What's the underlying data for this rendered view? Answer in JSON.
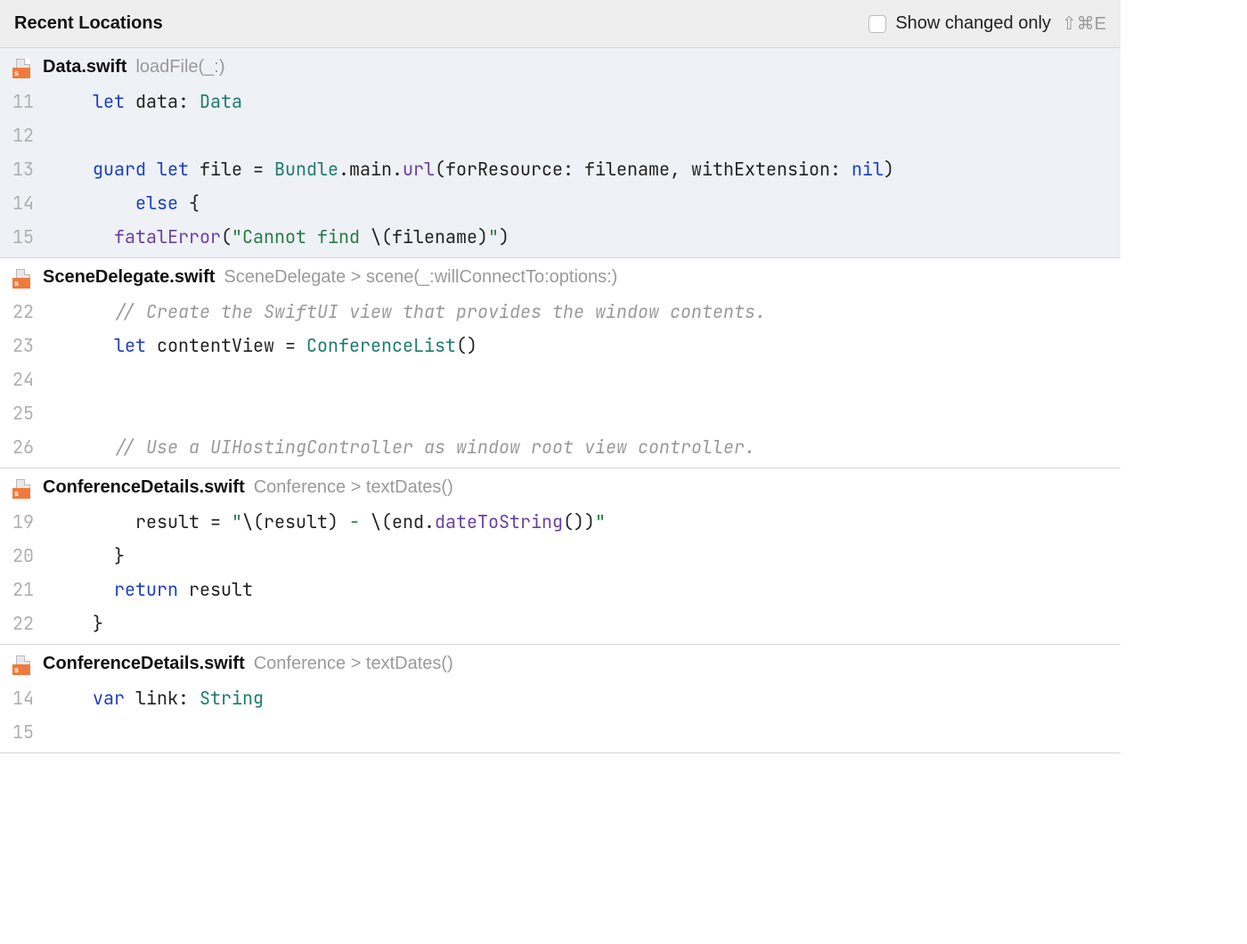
{
  "header": {
    "title": "Recent Locations",
    "show_changed_label": "Show changed only",
    "shortcut": "⇧⌘E"
  },
  "locations": [
    {
      "filename": "Data.swift",
      "path": "loadFile(_:)",
      "selected": true,
      "lines": [
        {
          "n": 11,
          "tokens": [
            [
              "    ",
              "pl"
            ],
            [
              "let",
              "kw"
            ],
            [
              " ",
              "pl"
            ],
            [
              "data",
              "id"
            ],
            [
              ": ",
              "pl"
            ],
            [
              "Data",
              "type"
            ]
          ]
        },
        {
          "n": 12,
          "tokens": []
        },
        {
          "n": 13,
          "tokens": [
            [
              "    ",
              "pl"
            ],
            [
              "guard",
              "kw"
            ],
            [
              " ",
              "pl"
            ],
            [
              "let",
              "kw"
            ],
            [
              " ",
              "pl"
            ],
            [
              "file",
              "id"
            ],
            [
              " = ",
              "pl"
            ],
            [
              "Bundle",
              "type"
            ],
            [
              ".main.",
              "pl"
            ],
            [
              "url",
              "fn"
            ],
            [
              "(forResource: filename, withExtension: ",
              "pl"
            ],
            [
              "nil",
              "nil"
            ],
            [
              ")",
              "pl"
            ]
          ]
        },
        {
          "n": 14,
          "tokens": [
            [
              "        ",
              "pl"
            ],
            [
              "else",
              "kw"
            ],
            [
              " {",
              "pl"
            ]
          ]
        },
        {
          "n": 15,
          "tokens": [
            [
              "      ",
              "pl"
            ],
            [
              "fatalError",
              "fn"
            ],
            [
              "(",
              "pl"
            ],
            [
              "\"Cannot find ",
              "str"
            ],
            [
              "\\(",
              "pl"
            ],
            [
              "filename",
              "id"
            ],
            [
              ")",
              "pl"
            ],
            [
              "\"",
              "str"
            ],
            [
              ")",
              "pl"
            ]
          ]
        }
      ]
    },
    {
      "filename": "SceneDelegate.swift",
      "path": "SceneDelegate > scene(_:willConnectTo:options:)",
      "selected": false,
      "lines": [
        {
          "n": 22,
          "tokens": [
            [
              "      ",
              "pl"
            ],
            [
              "// Create the SwiftUI view that provides the window contents.",
              "cmt"
            ]
          ]
        },
        {
          "n": 23,
          "tokens": [
            [
              "      ",
              "pl"
            ],
            [
              "let",
              "kw"
            ],
            [
              " ",
              "pl"
            ],
            [
              "contentView",
              "id"
            ],
            [
              " = ",
              "pl"
            ],
            [
              "ConferenceList",
              "type"
            ],
            [
              "()",
              "pl"
            ]
          ]
        },
        {
          "n": 24,
          "tokens": []
        },
        {
          "n": 25,
          "tokens": []
        },
        {
          "n": 26,
          "tokens": [
            [
              "      ",
              "pl"
            ],
            [
              "// Use a UIHostingController as window root view controller.",
              "cmt"
            ]
          ]
        }
      ]
    },
    {
      "filename": "ConferenceDetails.swift",
      "path": "Conference > textDates()",
      "selected": false,
      "lines": [
        {
          "n": 19,
          "tokens": [
            [
              "        ",
              "pl"
            ],
            [
              "result",
              "id"
            ],
            [
              " = ",
              "pl"
            ],
            [
              "\"",
              "str"
            ],
            [
              "\\(",
              "pl"
            ],
            [
              "result",
              "id"
            ],
            [
              ")",
              "pl"
            ],
            [
              " - ",
              "str"
            ],
            [
              "\\(",
              "pl"
            ],
            [
              "end",
              "id"
            ],
            [
              ".",
              "pl"
            ],
            [
              "dateToString",
              "fn"
            ],
            [
              "())",
              "pl"
            ],
            [
              "\"",
              "str"
            ]
          ]
        },
        {
          "n": 20,
          "tokens": [
            [
              "      }",
              "pl"
            ]
          ]
        },
        {
          "n": 21,
          "tokens": [
            [
              "      ",
              "pl"
            ],
            [
              "return",
              "kw"
            ],
            [
              " ",
              "pl"
            ],
            [
              "result",
              "id"
            ]
          ]
        },
        {
          "n": 22,
          "tokens": [
            [
              "    }",
              "pl"
            ]
          ]
        }
      ]
    },
    {
      "filename": "ConferenceDetails.swift",
      "path": "Conference > textDates()",
      "selected": false,
      "lines": [
        {
          "n": 14,
          "tokens": [
            [
              "    ",
              "pl"
            ],
            [
              "var",
              "kw"
            ],
            [
              " ",
              "pl"
            ],
            [
              "link",
              "id"
            ],
            [
              ": ",
              "pl"
            ],
            [
              "String",
              "type"
            ]
          ]
        },
        {
          "n": 15,
          "tokens": []
        }
      ]
    }
  ]
}
